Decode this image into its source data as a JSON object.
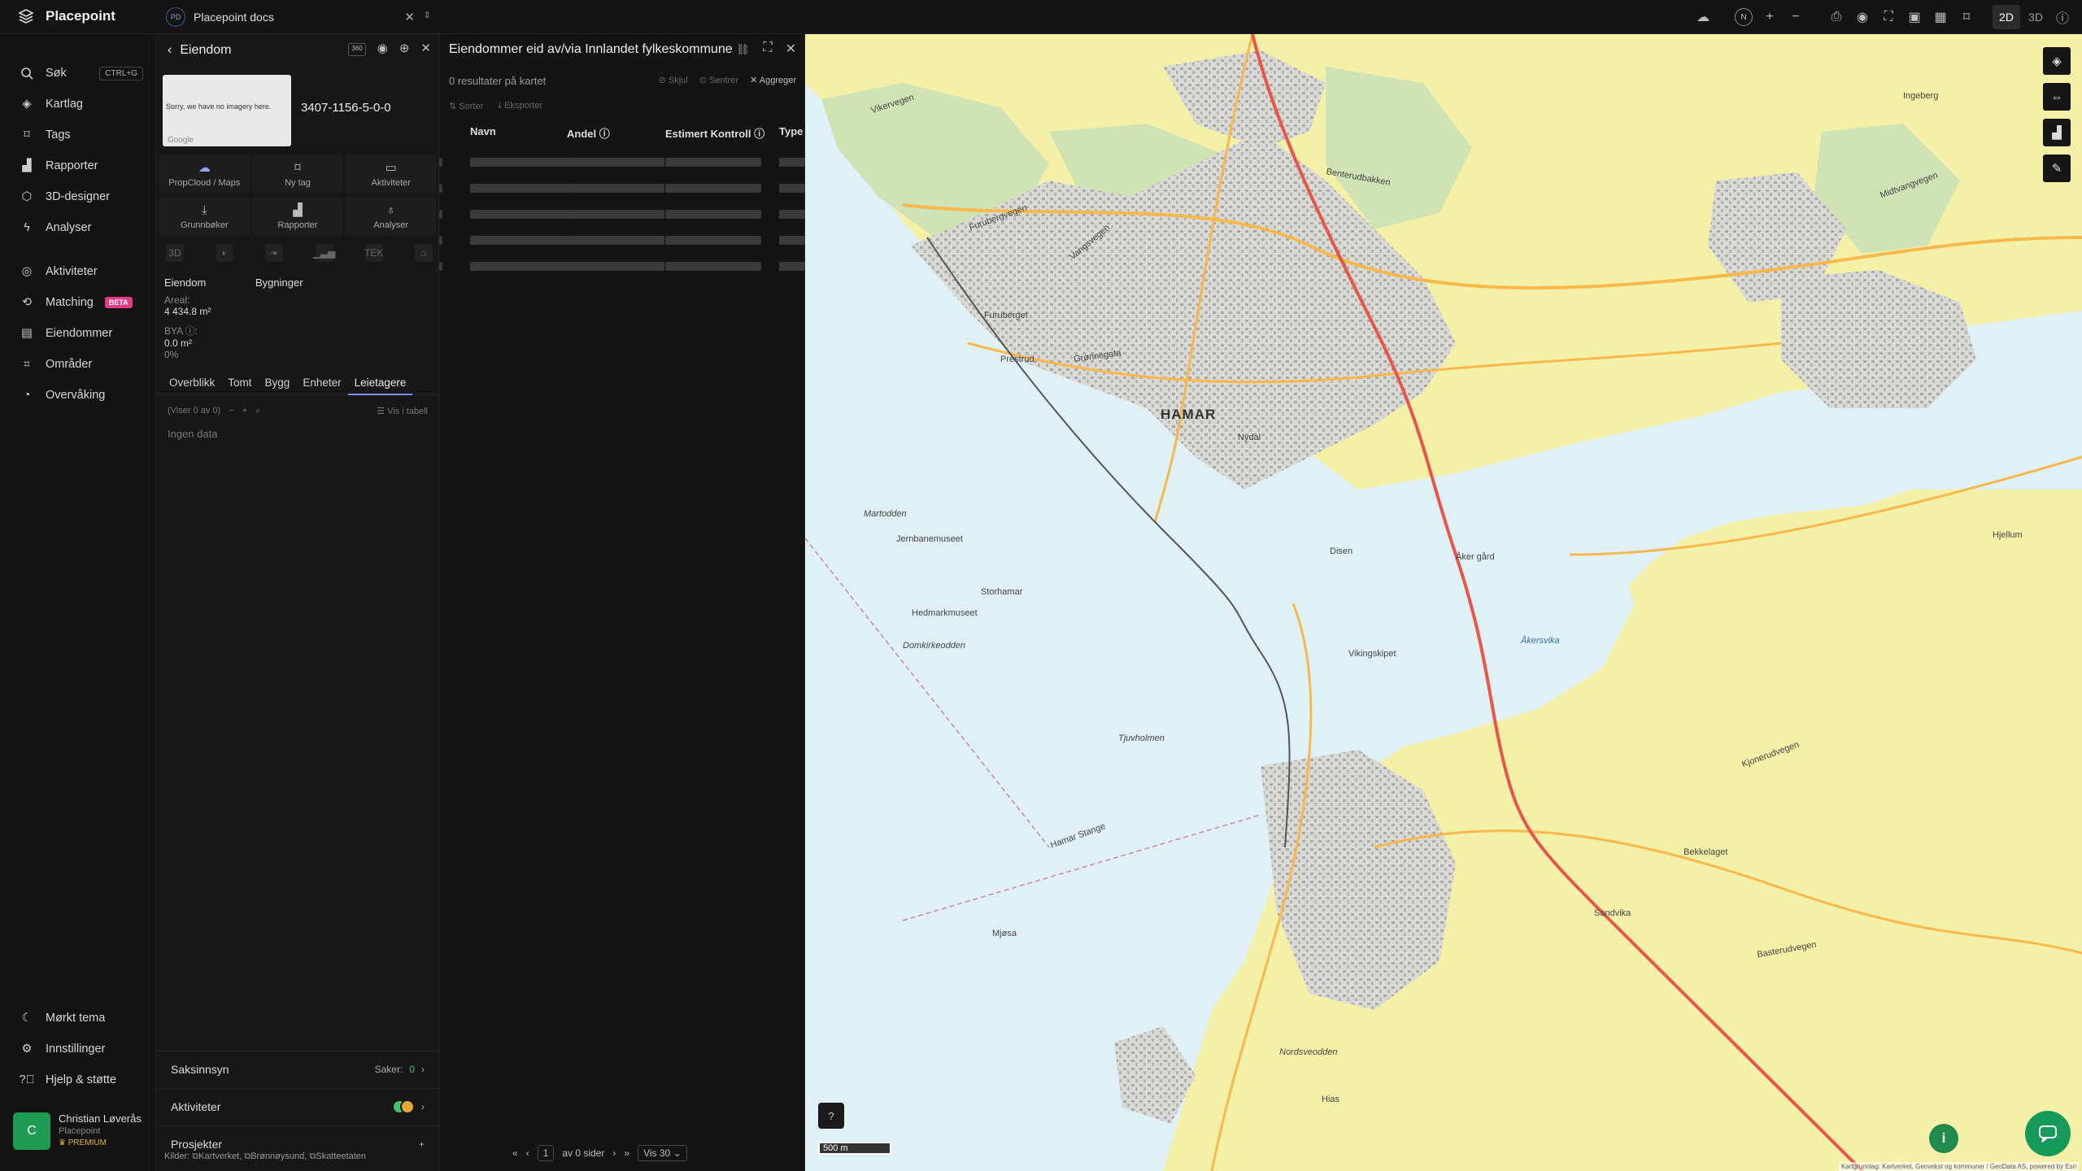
{
  "app": {
    "name": "Placepoint"
  },
  "workspace": {
    "initials": "PD",
    "name": "Placepoint docs"
  },
  "nav": {
    "top": [
      {
        "label": "Søk",
        "icon": "search-icon",
        "shortcut": "CTRL+G"
      },
      {
        "label": "Kartlag",
        "icon": "layers-icon"
      },
      {
        "label": "Tags",
        "icon": "bookmark-icon"
      },
      {
        "label": "Rapporter",
        "icon": "chart-icon"
      },
      {
        "label": "3D-designer",
        "icon": "cube-icon"
      },
      {
        "label": "Analyser",
        "icon": "bolt-icon"
      }
    ],
    "mid": [
      {
        "label": "Aktiviteter",
        "icon": "activity-icon"
      },
      {
        "label": "Matching",
        "icon": "matching-icon",
        "badge": "BETA"
      },
      {
        "label": "Eiendommer",
        "icon": "building-icon"
      },
      {
        "label": "Områder",
        "icon": "area-icon"
      },
      {
        "label": "Overvåking",
        "icon": "monitor-icon"
      }
    ],
    "bottom": [
      {
        "label": "Mørkt tema",
        "icon": "moon-icon"
      },
      {
        "label": "Innstillinger",
        "icon": "gear-icon"
      },
      {
        "label": "Hjelp & støtte",
        "icon": "help-icon"
      }
    ],
    "user": {
      "initial": "C",
      "name": "Christian Løverås",
      "org": "Placepoint",
      "plan": "PREMIUM"
    }
  },
  "property": {
    "title": "Eiendom",
    "imagery_text": "Sorry, we have no imagery here.",
    "google": "Google",
    "matrikkel": "3407-1156-5-0-0",
    "actions": [
      {
        "label": "PropCloud / Maps",
        "icon": "cloud-icon"
      },
      {
        "label": "Ny tag",
        "icon": "bookmark-icon"
      },
      {
        "label": "Aktiviteter",
        "icon": "chat-icon"
      },
      {
        "label": "Grunnbøker",
        "icon": "download-icon"
      },
      {
        "label": "Rapporter",
        "icon": "chart-icon"
      },
      {
        "label": "Analyser",
        "icon": "bulb-icon"
      }
    ],
    "mini_icons": [
      "3D",
      "◐",
      "❧",
      "▁▃▅",
      "TEK",
      "⌂"
    ],
    "section_eiendom": "Eiendom",
    "section_bygninger": "Bygninger",
    "areal_label": "Areal:",
    "areal_value": "4 434.8 m²",
    "bya_label": "BYA ⓘ:",
    "bya_value": "0.0 m²",
    "bya_pct": "0%",
    "tabs": [
      "Overblikk",
      "Tomt",
      "Bygg",
      "Enheter",
      "Leietagere"
    ],
    "active_tab": "Leietagere",
    "list_status": "(Viser 0 av 0)",
    "table_view": "Vis i tabell",
    "no_data": "Ingen data",
    "saksinnsyn": "Saksinnsyn",
    "saker_label": "Saker:",
    "saker_count": "0",
    "aktiviteter": "Aktiviteter",
    "prosjekter": "Prosjekter",
    "sources_label": "Kilder:",
    "sources": [
      "Kartverket,",
      "Brønnøysund,",
      "Skatteetaten"
    ]
  },
  "results": {
    "title": "Eiendommer eid av/via Innlandet fylkeskommune",
    "subtitle": "0 resultater på kartet",
    "tools": [
      "Skjul",
      "Sentrer",
      "Aggreger"
    ],
    "tools2": [
      "Sorter",
      "Eksporter"
    ],
    "columns": [
      "Navn",
      "Andel ⓘ",
      "Estimert Kontroll ⓘ",
      "Type"
    ],
    "skeleton_rows": 5,
    "pager": {
      "page": "1",
      "of_text": "av 0 sider",
      "per_page": "Vis 30"
    }
  },
  "map": {
    "labels": [
      {
        "text": "HAMAR",
        "big": true
      },
      {
        "text": "Vikervegen"
      },
      {
        "text": "Furubergvegen"
      },
      {
        "text": "Vangsvegen"
      },
      {
        "text": "Grønnegata"
      },
      {
        "text": "Benterudbakken"
      },
      {
        "text": "Midtvangvegen"
      },
      {
        "text": "Åkersvika",
        "blue": true
      },
      {
        "text": "Mjøsa"
      },
      {
        "text": "Martodden",
        "italic": true
      },
      {
        "text": "Jernbanemuseet"
      },
      {
        "text": "Hedmarkmuseet"
      },
      {
        "text": "Domkirkeodden",
        "italic": true
      },
      {
        "text": "Tjuvholmen",
        "italic": true
      },
      {
        "text": "Hamar Stange"
      },
      {
        "text": "Vikingskipet"
      },
      {
        "text": "Storhamar"
      },
      {
        "text": "Bekkelaget"
      },
      {
        "text": "Prestrud"
      },
      {
        "text": "Åker gård"
      },
      {
        "text": "Disen"
      },
      {
        "text": "Kjonerudvegen"
      },
      {
        "text": "Basterudvegen"
      },
      {
        "text": "Nordsveodden",
        "italic": true
      },
      {
        "text": "Hias"
      },
      {
        "text": "Sandvika"
      },
      {
        "text": "Ingeberg"
      },
      {
        "text": "Hjellum"
      },
      {
        "text": "Nydal"
      },
      {
        "text": "Furuberget"
      }
    ],
    "scale": "500 m",
    "attribution": "Kartgrunnlag: Kartverket, Geovekst og kommuner / GeoData AS, powered by Esri"
  },
  "toolbar": {
    "mode_2d": "2D",
    "mode_3d": "3D",
    "north": "N"
  }
}
